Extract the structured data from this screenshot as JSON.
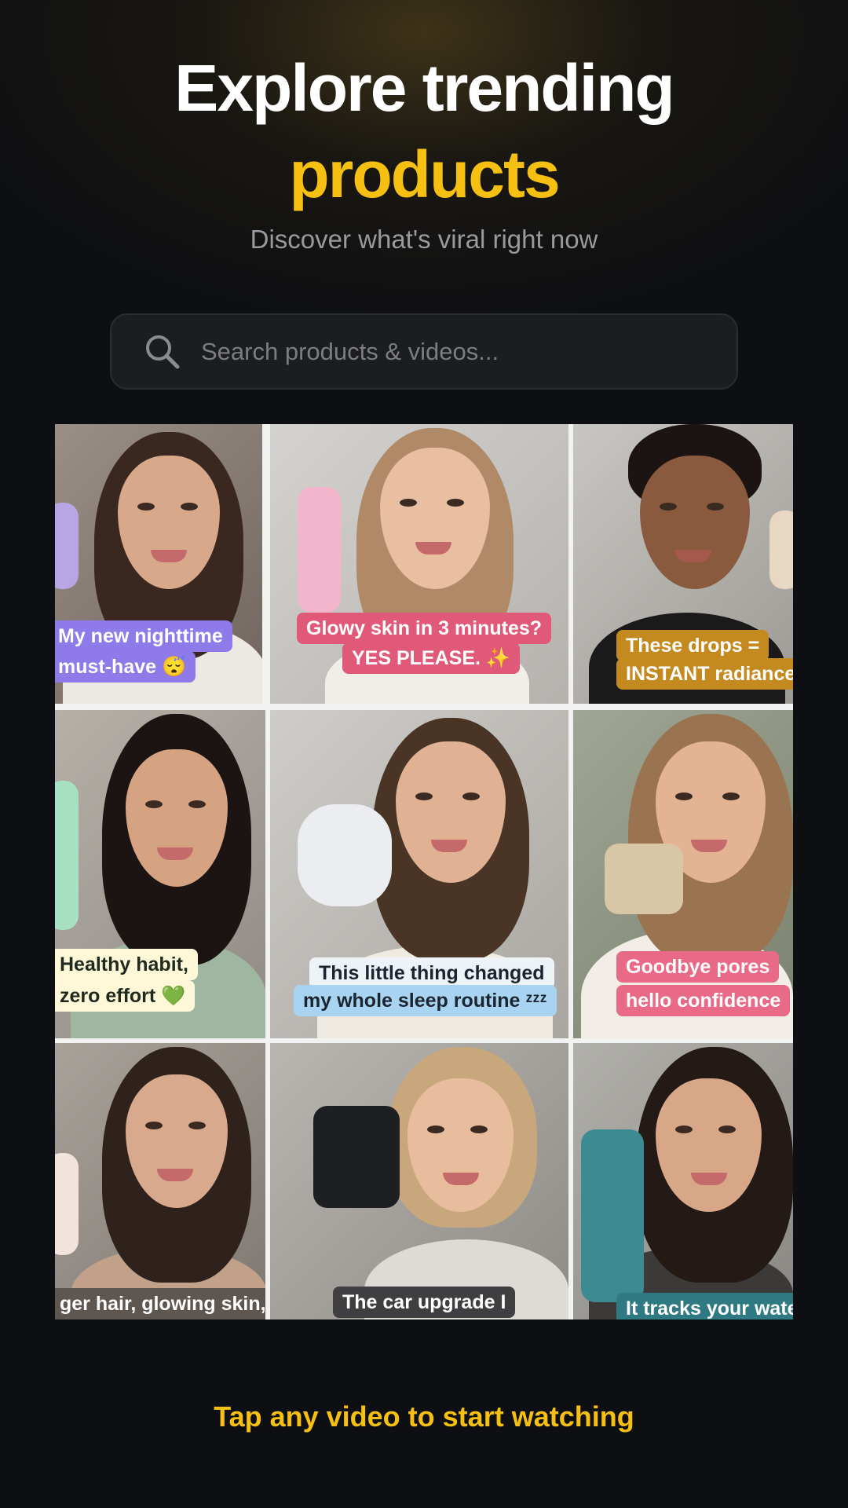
{
  "header": {
    "title_line1": "Explore trending",
    "title_line2": "products",
    "subtitle": "Discover what's viral right now"
  },
  "search": {
    "placeholder": "Search products & videos..."
  },
  "videos": [
    {
      "caption_line1": "My new nighttime",
      "caption_line2": "must-have 😴"
    },
    {
      "caption_line1": "Glowy skin in 3 minutes?",
      "caption_line2": "YES PLEASE. ✨"
    },
    {
      "caption_line1": "These drops =",
      "caption_line2": "INSTANT radiance"
    },
    {
      "caption_line1": "Healthy habit,",
      "caption_line2": "zero effort 💚"
    },
    {
      "caption_line1": "This little thing changed",
      "caption_line2": "my whole sleep routine ᶻᶻᶻ"
    },
    {
      "caption_line1": "Goodbye pores",
      "caption_line2": "hello confidence"
    },
    {
      "caption_line1": "ger hair, glowing skin,"
    },
    {
      "caption_line1": "The car upgrade I"
    },
    {
      "caption_line1": "It tracks your water"
    }
  ],
  "footer": {
    "cta": "Tap any video to start watching"
  },
  "colors": {
    "accent": "#f6c012",
    "background": "#0e0f12"
  },
  "icons": {
    "search": "search-icon"
  }
}
